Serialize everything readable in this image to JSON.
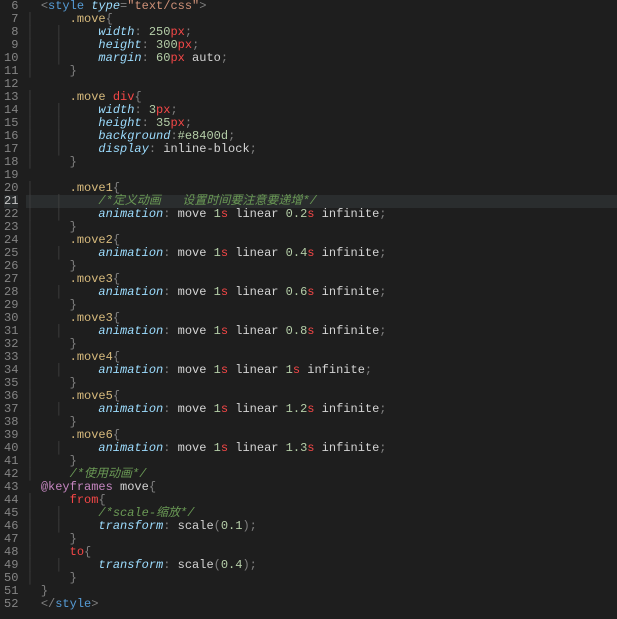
{
  "gutter": {
    "start": 6,
    "end": 52,
    "activeLine": 21
  },
  "code": {
    "l6": {
      "i": "  ",
      "a": "<",
      "b": "style",
      "c": " ",
      "d": "type",
      "e": "=",
      "f": "\"text/css\"",
      "g": ">"
    },
    "l7": {
      "i": "      ",
      "s": ".move",
      "b": "{"
    },
    "l8": {
      "i": "          ",
      "p": "width",
      "c": ": ",
      "n": "250",
      "u": "px",
      "e": ";"
    },
    "l9": {
      "i": "          ",
      "p": "height",
      "c": ": ",
      "n": "300",
      "u": "px",
      "e": ";"
    },
    "l10": {
      "i": "          ",
      "p": "margin",
      "c": ": ",
      "n": "60",
      "u": "px",
      "v": " auto",
      "e": ";"
    },
    "l11": {
      "i": "      ",
      "b": "}"
    },
    "l12": {
      "i": ""
    },
    "l13": {
      "i": "      ",
      "s": ".move ",
      "s2": "div",
      "b": "{"
    },
    "l14": {
      "i": "          ",
      "p": "width",
      "c": ": ",
      "n": "3",
      "u": "px",
      "e": ";"
    },
    "l15": {
      "i": "          ",
      "p": "height",
      "c": ": ",
      "n": "35",
      "u": "px",
      "e": ";"
    },
    "l16": {
      "i": "          ",
      "p": "background",
      "c": ":",
      "hex": "#e8400d",
      "e": ";"
    },
    "l17": {
      "i": "          ",
      "p": "display",
      "c": ": ",
      "v": "inline-block",
      "e": ";"
    },
    "l18": {
      "i": "      ",
      "b": "}"
    },
    "l19": {
      "i": ""
    },
    "l20": {
      "i": "      ",
      "s": ".move1",
      "b": "{"
    },
    "l21": {
      "i": "          ",
      "cm": "/*定义动画   设置时间要注意要递增*/"
    },
    "l22": {
      "i": "          ",
      "p": "animation",
      "c": ": ",
      "v1": "move ",
      "n1": "1",
      "u1": "s",
      "v2": " linear ",
      "n2": "0.2",
      "u2": "s",
      "v3": " infinite",
      "e": ";"
    },
    "l23": {
      "i": "      ",
      "b": "}"
    },
    "l24": {
      "i": "      ",
      "s": ".move2",
      "b": "{"
    },
    "l25": {
      "i": "          ",
      "p": "animation",
      "c": ": ",
      "v1": "move ",
      "n1": "1",
      "u1": "s",
      "v2": " linear ",
      "n2": "0.4",
      "u2": "s",
      "v3": " infinite",
      "e": ";"
    },
    "l26": {
      "i": "      ",
      "b": "}"
    },
    "l27": {
      "i": "      ",
      "s": ".move3",
      "b": "{"
    },
    "l28": {
      "i": "          ",
      "p": "animation",
      "c": ": ",
      "v1": "move ",
      "n1": "1",
      "u1": "s",
      "v2": " linear ",
      "n2": "0.6",
      "u2": "s",
      "v3": " infinite",
      "e": ";"
    },
    "l29": {
      "i": "      ",
      "b": "}"
    },
    "l30": {
      "i": "      ",
      "s": ".move3",
      "b": "{"
    },
    "l31": {
      "i": "          ",
      "p": "animation",
      "c": ": ",
      "v1": "move ",
      "n1": "1",
      "u1": "s",
      "v2": " linear ",
      "n2": "0.8",
      "u2": "s",
      "v3": " infinite",
      "e": ";"
    },
    "l32": {
      "i": "      ",
      "b": "}"
    },
    "l33": {
      "i": "      ",
      "s": ".move4",
      "b": "{"
    },
    "l34": {
      "i": "          ",
      "p": "animation",
      "c": ": ",
      "v1": "move ",
      "n1": "1",
      "u1": "s",
      "v2": " linear ",
      "n2": "1",
      "u2": "s",
      "v3": " infinite",
      "e": ";"
    },
    "l35": {
      "i": "      ",
      "b": "}"
    },
    "l36": {
      "i": "      ",
      "s": ".move5",
      "b": "{"
    },
    "l37": {
      "i": "          ",
      "p": "animation",
      "c": ": ",
      "v1": "move ",
      "n1": "1",
      "u1": "s",
      "v2": " linear ",
      "n2": "1.2",
      "u2": "s",
      "v3": " infinite",
      "e": ";"
    },
    "l38": {
      "i": "      ",
      "b": "}"
    },
    "l39": {
      "i": "      ",
      "s": ".move6",
      "b": "{"
    },
    "l40": {
      "i": "          ",
      "p": "animation",
      "c": ": ",
      "v1": "move ",
      "n1": "1",
      "u1": "s",
      "v2": " linear ",
      "n2": "1.3",
      "u2": "s",
      "v3": " infinite",
      "e": ";"
    },
    "l41": {
      "i": "      ",
      "b": "}"
    },
    "l42": {
      "i": "      ",
      "cm": "/*使用动画*/"
    },
    "l43": {
      "i": "  ",
      "kw": "@keyframes",
      "v": " move",
      "b": "{"
    },
    "l44": {
      "i": "      ",
      "k": "from",
      "b": "{"
    },
    "l45": {
      "i": "          ",
      "cm": "/*scale-缩放*/"
    },
    "l46": {
      "i": "          ",
      "p": "transform",
      "c": ": ",
      "fn": "scale",
      "op": "(",
      "n": "0.1",
      "cp": ")",
      "e": ";"
    },
    "l47": {
      "i": "      ",
      "b": "}"
    },
    "l48": {
      "i": "      ",
      "k": "to",
      "b": "{"
    },
    "l49": {
      "i": "          ",
      "p": "transform",
      "c": ": ",
      "fn": "scale",
      "op": "(",
      "n": "0.4",
      "cp": ")",
      "e": ";"
    },
    "l50": {
      "i": "      ",
      "b": "}"
    },
    "l51": {
      "i": "  ",
      "b": "}"
    },
    "l52": {
      "i": "  ",
      "a": "</",
      "b": "style",
      "g": ">"
    }
  }
}
